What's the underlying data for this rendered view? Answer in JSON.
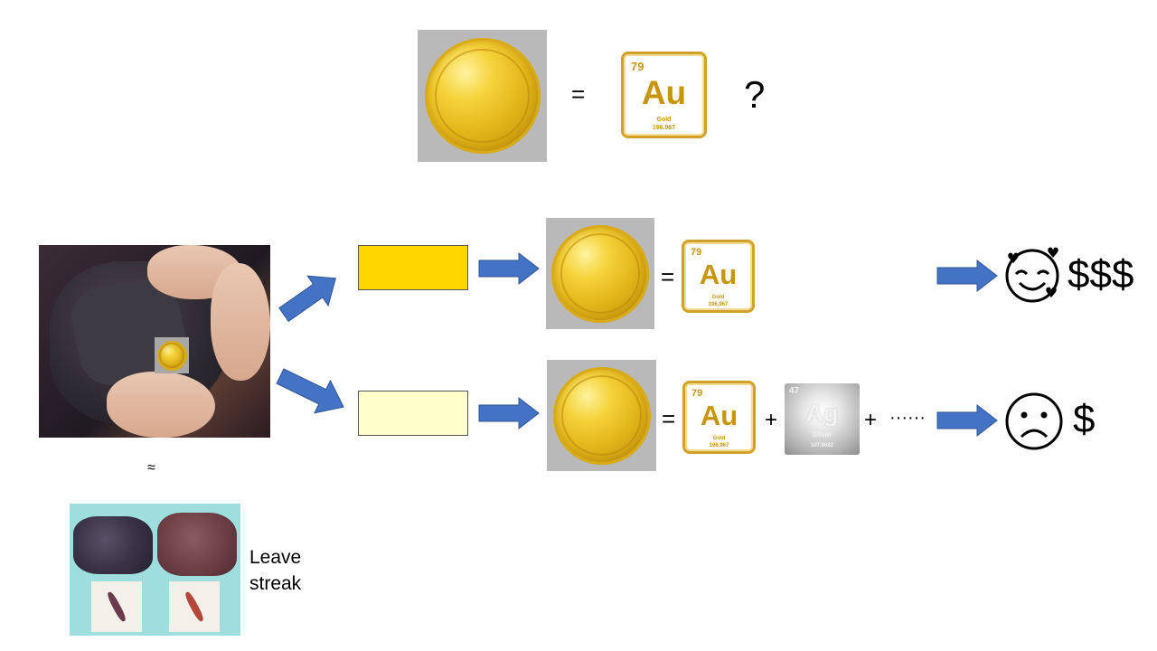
{
  "top_row": {
    "equals": "=",
    "question": "?"
  },
  "element_gold": {
    "number": "79",
    "symbol": "Au",
    "name": "Gold",
    "mass": "196.967"
  },
  "element_silver": {
    "number": "47",
    "symbol": "Ag",
    "name": "Silver",
    "mass": "107.8682"
  },
  "branch_top": {
    "equals": "=",
    "result_money": "$$$",
    "box_color": "#ffd700"
  },
  "branch_bottom": {
    "equals": "=",
    "plus": "+",
    "plus_2": "+",
    "ellipsis": "······",
    "result_money": "$",
    "box_color": "#ffffcc"
  },
  "approx_symbol": "≈",
  "streak_label": {
    "line1": "Leave",
    "line2": "streak"
  },
  "colors": {
    "arrow": "#4472c4",
    "arrow_outline": "#2f5597",
    "gold_text": "#c8960c"
  }
}
